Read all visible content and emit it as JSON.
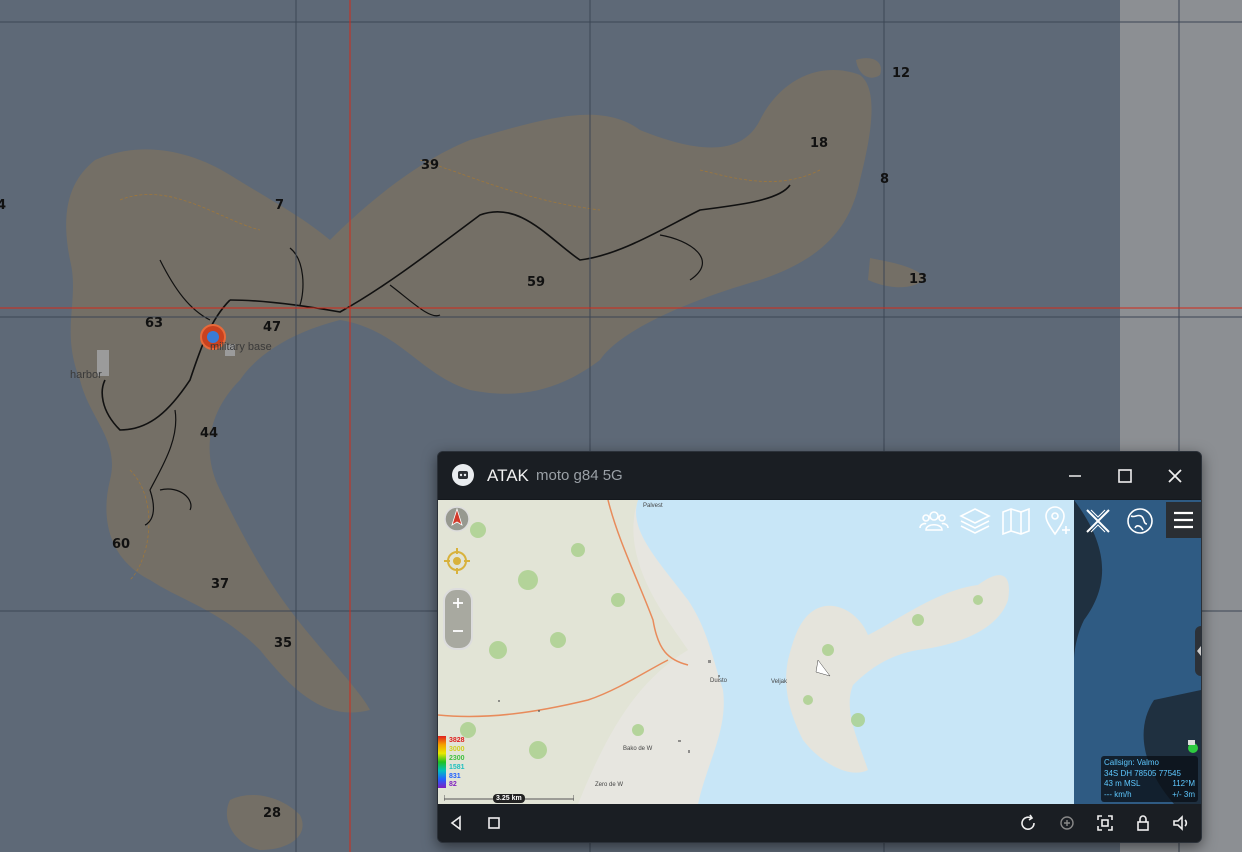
{
  "background_map": {
    "grid_numbers": [
      "12",
      "18",
      "8",
      "13",
      "39",
      "7",
      "59",
      "63",
      "47",
      "44",
      "60",
      "37",
      "35",
      "28",
      "4"
    ],
    "place_labels": [
      "military base",
      "harbor"
    ]
  },
  "window": {
    "app_name": "ATAK",
    "device_name": "moto g84 5G",
    "controls": [
      "minimize-icon",
      "maximize-icon",
      "close-icon"
    ]
  },
  "toolbar": {
    "icons": [
      "contacts-icon",
      "layers-icon",
      "maps-icon",
      "add-point-icon",
      "close-tools-icon",
      "globe-icon",
      "menu-icon"
    ]
  },
  "left_tools": {
    "icons": [
      "north-compass-icon",
      "locate-self-icon",
      "zoom-in-icon",
      "zoom-out-icon"
    ]
  },
  "scale_bar": {
    "label": "3.25 km"
  },
  "elevation_legend": {
    "values": [
      "3828",
      "3000",
      "2300",
      "1581",
      "831",
      "82"
    ],
    "colors": [
      "#e02020",
      "#d0d020",
      "#40c040",
      "#20c0c0",
      "#2060ff",
      "#8020c0"
    ]
  },
  "callsign_box": {
    "callsign": "Callsign: Valmo",
    "mgrs": "34S  DH  78505  77545",
    "altitude": "43 m MSL",
    "heading": "112°M",
    "speed": "--- km/h",
    "accuracy": "+/- 3m"
  },
  "map_labels": [
    "Palvest",
    "Veljak",
    "Duisto",
    "Bako de W",
    "Zero de W"
  ],
  "nav_bar": {
    "icons": [
      "back-icon",
      "recents-icon",
      "rotate-icon",
      "auto-rotate-icon",
      "screenshot-icon",
      "lock-icon",
      "volume-icon"
    ]
  },
  "colors": {
    "accent": "#5ec8ff",
    "crosshair": "#d22a1a",
    "water": "#c8e6f7"
  }
}
